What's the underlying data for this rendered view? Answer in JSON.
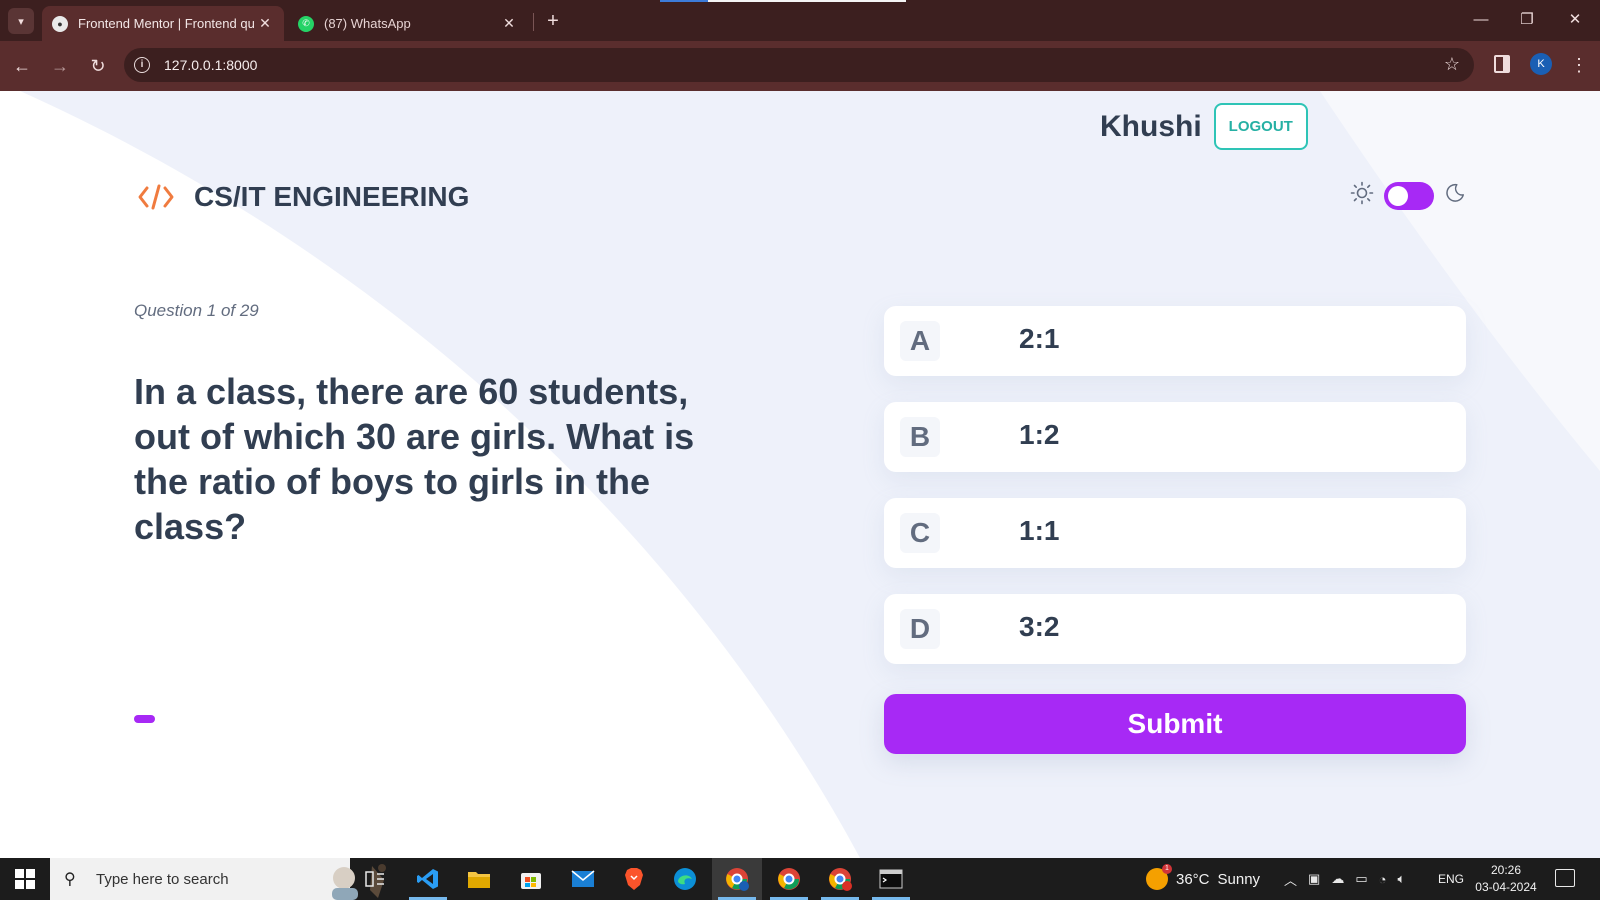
{
  "browser": {
    "tabs": [
      {
        "title": "Frontend Mentor | Frontend qu",
        "favicon": "frontend-mentor-icon",
        "active": true
      },
      {
        "title": "(87) WhatsApp",
        "favicon": "whatsapp-icon",
        "active": false
      }
    ],
    "url": "127.0.0.1:8000",
    "profile_initial": "K"
  },
  "header": {
    "username": "Khushi",
    "logout_label": "LOGOUT",
    "subject_title": "CS/IT ENGINEERING",
    "subject_icon": "code-icon",
    "theme_toggle": {
      "mode": "dark",
      "sun_icon": "sun-icon",
      "moon_icon": "moon-icon"
    }
  },
  "quiz": {
    "progress_text": "Question 1 of 29",
    "progress_fraction": 0.3448,
    "question": "In a class, there are 60 students, out of which 30 are girls. What is the ratio of boys to girls in the class?",
    "options": [
      {
        "letter": "A",
        "text": "2:1"
      },
      {
        "letter": "B",
        "text": "1:2"
      },
      {
        "letter": "C",
        "text": "1:1"
      },
      {
        "letter": "D",
        "text": "3:2"
      }
    ],
    "submit_label": "Submit"
  },
  "colors": {
    "accent": "#a729f5",
    "teal": "#2ec4b6",
    "heading": "#313e51",
    "background_shape": "#eef1fa"
  },
  "taskbar": {
    "search_placeholder": "Type here to search",
    "apps": [
      "task-view-icon",
      "vscode-icon",
      "file-explorer-icon",
      "microsoft-store-icon",
      "mail-icon",
      "brave-icon",
      "edge-icon",
      "chrome-profile-icon",
      "chrome-icon",
      "chrome-alt-icon",
      "terminal-icon"
    ],
    "weather": {
      "temp": "36°C",
      "condition": "Sunny",
      "badge": "1"
    },
    "language": "ENG",
    "time": "20:26",
    "date": "03-04-2024"
  }
}
